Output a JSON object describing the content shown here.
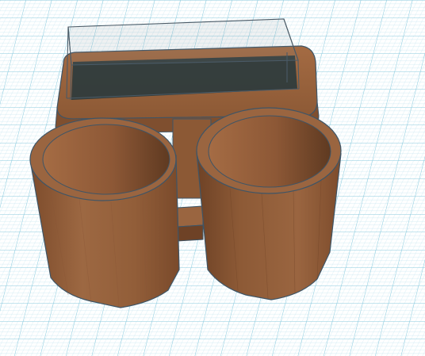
{
  "scene": {
    "workplane": {
      "background_color": "#ffffff",
      "minor_grid_color": "#bfe3ef",
      "major_grid_color": "#86c9dd"
    },
    "model": {
      "body_color": "#9a6540",
      "body_shadow_color": "#7a4c2e",
      "edge_color": "#3f5566",
      "cup_inner_color": "#8a5637",
      "tray_floor_color": "#2d3b3d",
      "hole_box_color": "#4a5a66"
    }
  }
}
